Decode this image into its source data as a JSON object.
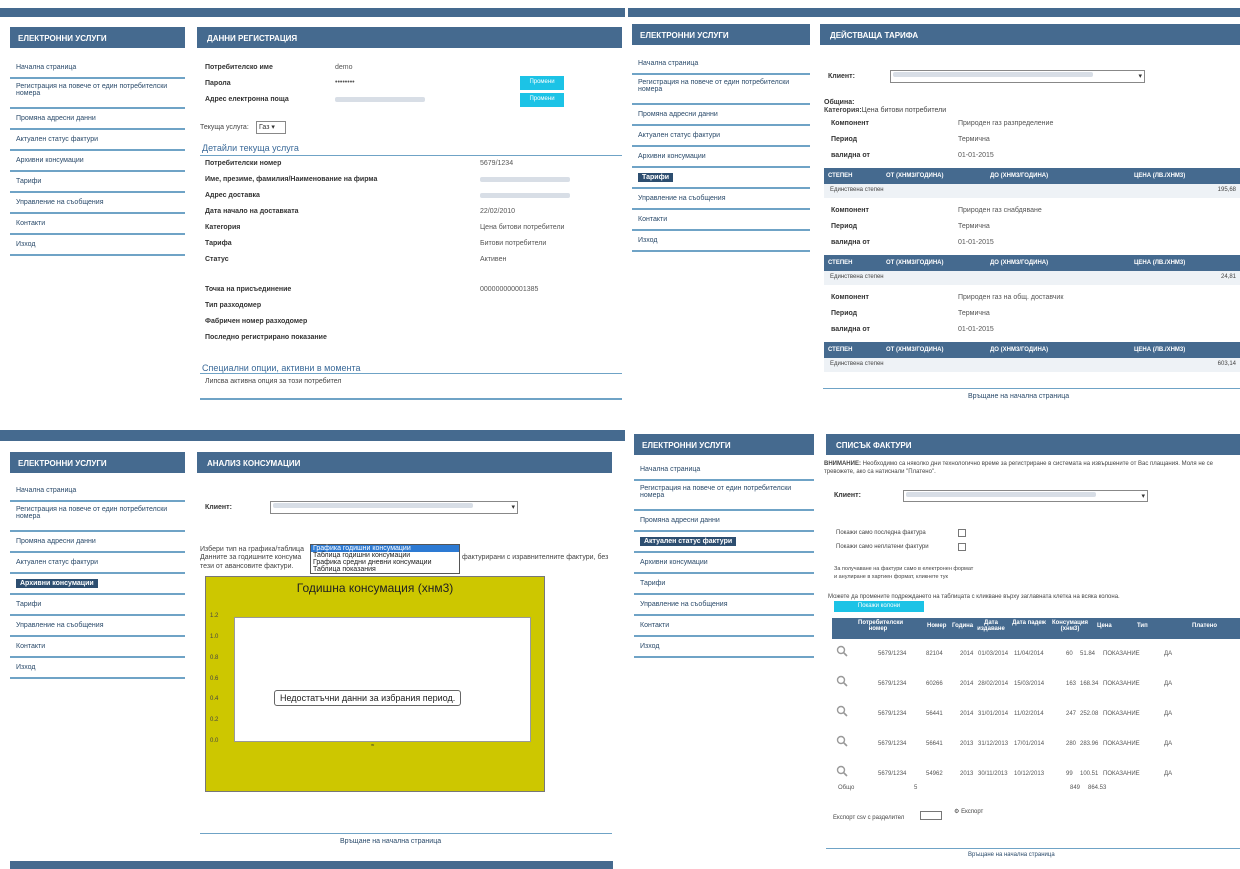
{
  "colors": {
    "header": "#456a8f",
    "accent": "#1cc3e6",
    "rule": "#6fa3c6",
    "chart_bg": "#cdc700"
  },
  "sidebar_title": "ЕЛЕКТРОННИ УСЛУГИ",
  "nav": {
    "home": "Начална страница",
    "multi_reg": "Регистрация на повече от един потребителски номера",
    "address": "Промяна адресни данни",
    "invoices": "Актуален статус фактури",
    "archive": "Архивни консумации",
    "tariffs": "Тарифи",
    "messages": "Управление на съобщения",
    "contacts": "Контакти",
    "exit": "Изход"
  },
  "p1": {
    "title": "ДАННИ РЕГИСТРАЦИЯ",
    "username_label": "Потребителско име",
    "username_value": "demo",
    "password_label": "Парола",
    "password_value": "••••••••",
    "email_label": "Адрес електронна поща",
    "change": "Промени",
    "service_label": "Текуща услуга:",
    "service_value": "Газ",
    "details_title": "Детайли текуща услуга",
    "rows": [
      {
        "label": "Потребителски номер",
        "value": "5679/1234"
      },
      {
        "label": "Име, презиме, фамилия/Наименование на фирма",
        "value": ""
      },
      {
        "label": "Адрес доставка",
        "value": ""
      },
      {
        "label": "Дата начало на доставката",
        "value": "22/02/2010"
      },
      {
        "label": "Категория",
        "value": "Цена битови потребители"
      },
      {
        "label": "Тарифа",
        "value": "Битови потребители"
      },
      {
        "label": "Статус",
        "value": "Активен"
      }
    ],
    "rows2": [
      {
        "label": "Точка на присъединение",
        "value": "000000000001385"
      },
      {
        "label": "Тип разходомер",
        "value": ""
      },
      {
        "label": "Фабричен номер разходомер",
        "value": ""
      },
      {
        "label": "Последно регистрирано показание",
        "value": ""
      }
    ],
    "special_title": "Специални опции, активни в момента",
    "special_text": "Липсва активна опция за този потребител"
  },
  "p2": {
    "title": "ДЕЙСТВАЩА ТАРИФА",
    "client_label": "Клиент:",
    "municipality_label": "Община:",
    "category_label": "Категория:",
    "category_value": "Цена битови потребители",
    "component_label": "Компонент",
    "period_label": "Период",
    "valid_label": "валидна от",
    "period_value": "Термична",
    "valid_value": "01-01-2015",
    "th": [
      "СТЕПЕН",
      "ОТ (ХНМ3/ГОДИНА)",
      "ДО (ХНМ3/ГОДИНА)",
      "ЦЕНА (ЛВ./ХНМ3)"
    ],
    "single": "Единствена степен",
    "blocks": [
      {
        "component": "Природен газ разпределение",
        "price": "195,68"
      },
      {
        "component": "Природен газ снабдяване",
        "price": "24,81"
      },
      {
        "component": "Природен газ на общ. доставчик",
        "price": "603,14"
      }
    ],
    "back": "Връщане на начална страница"
  },
  "p3": {
    "title": "АНАЛИЗ КОНСУМАЦИИ",
    "client_label": "Клиент:",
    "choose_label": "Избери тип на графика/таблица",
    "note1": "Данните за годишните консума",
    "note1b": "фактурирани с изравнителните фактури, без",
    "note2": "тези от авансовите фактури.",
    "options": [
      "Графика годишни консумации",
      "Таблица годишни консумации",
      "Графика средни дневни консумации",
      "Таблица показания"
    ],
    "no_data": "Недостатъчни данни за избрания период.",
    "back": "Връщане на начална страница"
  },
  "chart_data": {
    "type": "bar",
    "title": "Годишна консумация (хнм3)",
    "categories": [],
    "values": [],
    "ylim": [
      0,
      1.2
    ],
    "yticks": [
      "1.2",
      "1.0",
      "0.8",
      "0.6",
      "0.4",
      "0.2",
      "0.0"
    ]
  },
  "p4": {
    "title": "СПИСЪК ФАКТУРИ",
    "warning_bold": "ВНИМАНИЕ:",
    "warning": "Необходимо са няколко дни технологично време за регистриране в системата на извършените от Вас плащания. Моля не се тревожете, ако са натиснали \"Платено\".",
    "client_label": "Клиент:",
    "only_last": "Покажи само последна фактура",
    "only_unpaid": "Покажи само неплатени фактури",
    "einvoice1": "За получаване на фактури само в електронен формат",
    "einvoice2": "и анулиране в хартиен формат, кликнете тук",
    "order_note": "Можете да промените подреждането на таблицата с кликване върху заглавната клетка на всяка колона.",
    "columns_btn": "Покажи колони",
    "th": [
      "Потребителски номер",
      "Номер",
      "Година",
      "Дата издаване",
      "Дата падеж",
      "Консумация (хнм3)",
      "Цена",
      "Тип",
      "Платено"
    ],
    "rows": [
      [
        "5679/1234",
        "82104",
        "2014",
        "01/03/2014",
        "11/04/2014",
        "60",
        "51.84",
        "ПОКАЗАНИЕ",
        "ДА"
      ],
      [
        "5679/1234",
        "60266",
        "2014",
        "28/02/2014",
        "15/03/2014",
        "163",
        "168.34",
        "ПОКАЗАНИЕ",
        "ДА"
      ],
      [
        "5679/1234",
        "56441",
        "2014",
        "31/01/2014",
        "11/02/2014",
        "247",
        "252.08",
        "ПОКАЗАНИЕ",
        "ДА"
      ],
      [
        "5679/1234",
        "56641",
        "2013",
        "31/12/2013",
        "17/01/2014",
        "280",
        "283.96",
        "ПОКАЗАНИЕ",
        "ДА"
      ],
      [
        "5679/1234",
        "54962",
        "2013",
        "30/11/2013",
        "10/12/2013",
        "99",
        "100.51",
        "ПОКАЗАНИЕ",
        "ДА"
      ]
    ],
    "total_label": "Общо",
    "total_count": "5",
    "total_consumption": "849",
    "total_price": "864.53",
    "export_label": "Експорт csv с разделител",
    "export_btn": "Експорт",
    "back": "Връщане на начална страница"
  }
}
